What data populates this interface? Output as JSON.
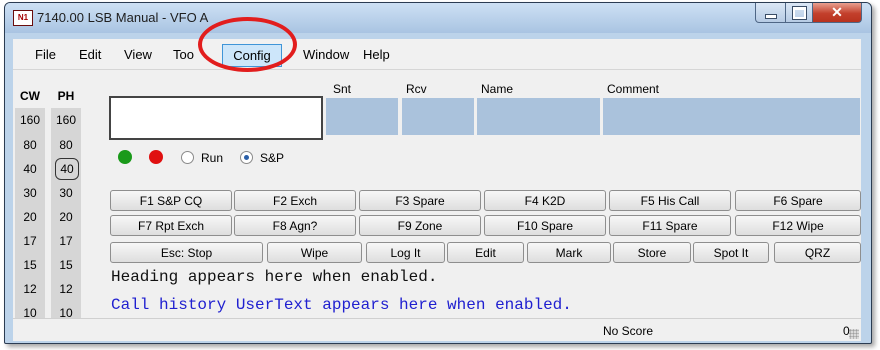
{
  "window": {
    "icon_text": "N1",
    "title": "7140.00 LSB Manual - VFO A",
    "minimize_icon": "minimize-icon",
    "maximize_icon": "maximize-icon",
    "close_icon": "close-icon",
    "close_glyph": "✕"
  },
  "menu": {
    "items": [
      "File",
      "Edit",
      "View",
      "Tools",
      "Config",
      "Window",
      "Help"
    ],
    "highlighted": "Config",
    "visible_tools": "Too",
    "visible_window": "Window"
  },
  "bands": {
    "cw_header": "CW",
    "ph_header": "PH",
    "cw": [
      "160",
      "80",
      "40",
      "30",
      "20",
      "17",
      "15",
      "12",
      "10"
    ],
    "ph": [
      "160",
      "80",
      "40",
      "30",
      "20",
      "17",
      "15",
      "12",
      "10"
    ],
    "selected_ph": "40"
  },
  "entry": {
    "call_value": "",
    "snt_label": "Snt",
    "rcv_label": "Rcv",
    "name_label": "Name",
    "comment_label": "Comment"
  },
  "mode": {
    "run_label": "Run",
    "sp_label": "S&P",
    "selected": "S&P"
  },
  "function_keys": {
    "row1": [
      "F1 S&P CQ",
      "F2 Exch",
      "F3 Spare",
      "F4 K2D",
      "F5 His Call",
      "F6 Spare"
    ],
    "row2": [
      "F7 Rpt Exch",
      "F8 Agn?",
      "F9 Zone",
      "F10 Spare",
      "F11 Spare",
      "F12 Wipe"
    ],
    "row3": [
      "Esc: Stop",
      "Wipe",
      "Log It",
      "Edit",
      "Mark",
      "Store",
      "Spot It",
      "QRZ"
    ]
  },
  "info": {
    "heading_text": "Heading appears here when enabled.",
    "call_history_text": "Call history UserText appears here when enabled."
  },
  "status": {
    "score": "No Score",
    "count": "0"
  },
  "colors": {
    "green_led": "#1a9a1a",
    "red_led": "#e01010",
    "highlight_circle": "#e21d1d",
    "call_history_blue": "#2020d0"
  }
}
